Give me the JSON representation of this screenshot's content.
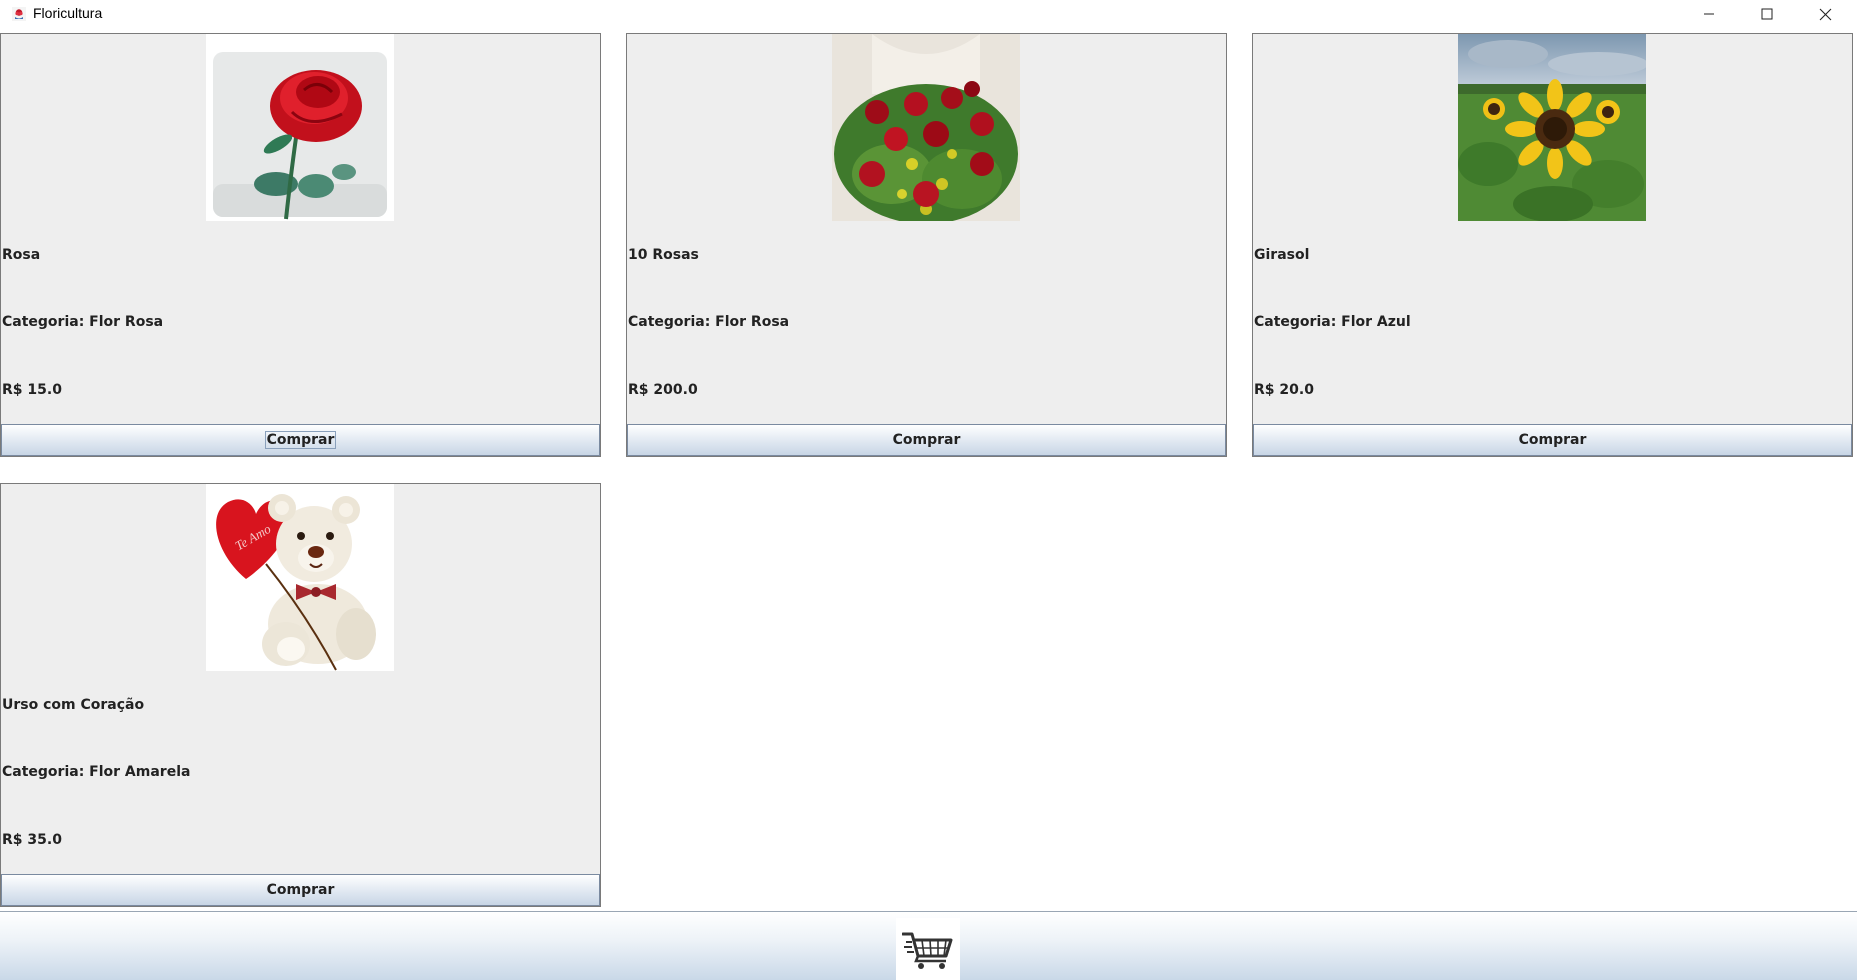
{
  "window": {
    "title": "Floricultura",
    "icon": "flower-app-icon",
    "controls": [
      "minimize-icon",
      "maximize-icon",
      "close-icon"
    ]
  },
  "products": [
    {
      "name": "Rosa",
      "category": "Categoria: Flor Rosa",
      "price": "R$ 15.0",
      "buy_label": "Comprar",
      "image": "red-rose"
    },
    {
      "name": "10 Rosas",
      "category": "Categoria: Flor Rosa",
      "price": "R$ 200.0",
      "buy_label": "Comprar",
      "image": "rose-bouquet"
    },
    {
      "name": "Girasol",
      "category": "Categoria: Flor Azul",
      "price": "R$ 20.0",
      "buy_label": "Comprar",
      "image": "sunflower-field"
    },
    {
      "name": "Urso com Coração",
      "category": "Categoria: Flor Amarela",
      "price": "R$ 35.0",
      "buy_label": "Comprar",
      "image": "teddy-bear-heart"
    }
  ],
  "bear_heart_text": "Te Amo",
  "cart": {
    "icon": "cart-icon"
  },
  "colors": {
    "card_bg": "#eeeeee",
    "button_gradient_bottom": "#c8d6e6",
    "border": "#7a7a7a"
  }
}
